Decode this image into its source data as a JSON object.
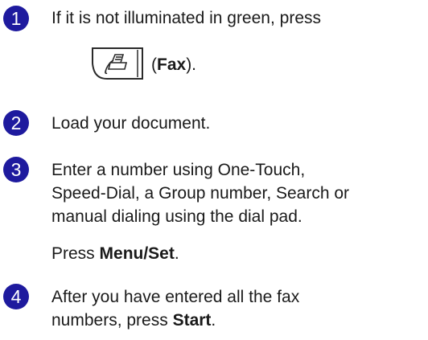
{
  "steps": [
    {
      "number": "1",
      "lines": [
        "If it is not illuminated in green, press"
      ],
      "key": {
        "icon": "fax-icon",
        "open_paren": "(",
        "label": "Fax",
        "close": ")."
      }
    },
    {
      "number": "2",
      "lines": [
        "Load your document."
      ]
    },
    {
      "number": "3",
      "lines": [
        "Enter a number using One-Touch,",
        "Speed-Dial, a Group number, Search or",
        "manual dialing using the dial pad."
      ],
      "press_prefix": "Press ",
      "press_key": "Menu/Set",
      "press_suffix": "."
    },
    {
      "number": "4",
      "lines": [
        "After you have entered all the fax",
        "numbers, press "
      ],
      "key_label": "Start",
      "key_suffix": "."
    }
  ],
  "colors": {
    "step_badge": "#1e1a9e",
    "text": "#1a1a1a"
  }
}
